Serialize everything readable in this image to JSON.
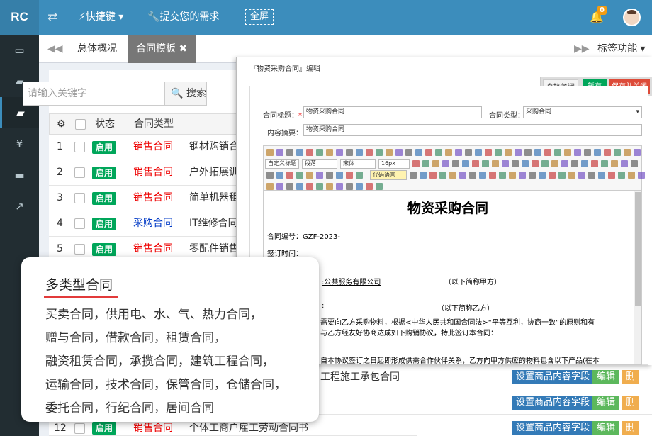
{
  "app": {
    "logo": "RC"
  },
  "topbar": {
    "shortcut_label": "快捷键",
    "request_label": "提交您的需求",
    "fullscreen_label": "全屏",
    "notification_count": "0"
  },
  "tabs": {
    "overview": "总体概况",
    "contract_template": "合同模板",
    "tab_functions": "标签功能"
  },
  "search": {
    "placeholder": "请输入关键字",
    "button_label": "搜索"
  },
  "table": {
    "headers": {
      "status": "状态",
      "contract_type": "合同类型"
    },
    "rows": [
      {
        "num": "1",
        "status": "启用",
        "type": "销售合同",
        "type_color": "#e00000",
        "name": "钢材购销合"
      },
      {
        "num": "2",
        "status": "启用",
        "type": "销售合同",
        "type_color": "#e00000",
        "name": "户外拓展训"
      },
      {
        "num": "3",
        "status": "启用",
        "type": "销售合同",
        "type_color": "#e00000",
        "name": "简单机器租"
      },
      {
        "num": "4",
        "status": "启用",
        "type": "采购合同",
        "type_color": "#0039c6",
        "name": "IT维修合同"
      },
      {
        "num": "5",
        "status": "启用",
        "type": "销售合同",
        "type_color": "#e00000",
        "name": "零配件销售"
      },
      {
        "num": "12",
        "status": "启用",
        "type": "销售合同",
        "type_color": "#e00000",
        "name": "个体工商户雇工劳动合同书"
      }
    ],
    "partial_row_name": "工程施工承包合同",
    "action_labels": {
      "set_fields": "设置商品内容字段",
      "edit": "编辑",
      "delete": "删"
    }
  },
  "modal": {
    "title": "『物资采购合同』编辑",
    "btn_close": "直接关闭",
    "btn_save": "暂存",
    "btn_save_close": "保存并关闭",
    "form": {
      "title_label": "合同标题：",
      "title_value": "物资采购合同",
      "type_label": "合同类型：",
      "type_value": "采购合同",
      "summary_label": "内容摘要：",
      "summary_value": "物资采购合同"
    },
    "toolbar": {
      "style_select": "自定义标题",
      "paragraph_select": "段落",
      "font_select": "宋体",
      "size_select": "16px",
      "code_select": "代码语言"
    },
    "document": {
      "heading": "物资采购合同",
      "contract_no": "合同编号：GZF-2023-",
      "sign_time": "签订时间：",
      "party_a_line": ":公共服务有限公司",
      "party_a_note": "（以下简称甲方）",
      "party_b_prefix": ":",
      "party_b_note": "（以下简称乙方）",
      "para1_line1": "需要向乙方采购物料，根据<中华人民共和国合同法>“平等互利，协商一致”的原则和有",
      "para1_line2": "与乙方经友好协商达成如下购销协议，特此签订本合同：",
      "para2": "自本协议签订之日起即形成供需合作伙伴关系，乙方向甲方供应的物料包含以下产品(在本"
    }
  },
  "callout": {
    "title": "多类型合同",
    "lines": [
      "买卖合同，供用电、水、气、热力合同，",
      "赠与合同，借款合同，租赁合同，",
      "融资租赁合同，承揽合同，建筑工程合同，",
      "运输合同，技术合同，保管合同，仓储合同，",
      "委托合同，行纪合同，居间合同"
    ]
  },
  "colors": {
    "topbar": "#3c8dbc",
    "sidebar": "#222d32",
    "enabled_badge": "#00a65a",
    "sales_red": "#e00000",
    "purchase_blue": "#0039c6",
    "edit_green": "#5cb85c",
    "set_fields_blue": "#337ab7"
  },
  "icons": [
    "swap-icon",
    "flash-icon",
    "wrench-icon",
    "bell-icon",
    "monitor-icon",
    "briefcase-icon",
    "toolbox-icon",
    "yen-icon",
    "folder-icon",
    "chart-icon",
    "gear-icon",
    "search-icon"
  ]
}
